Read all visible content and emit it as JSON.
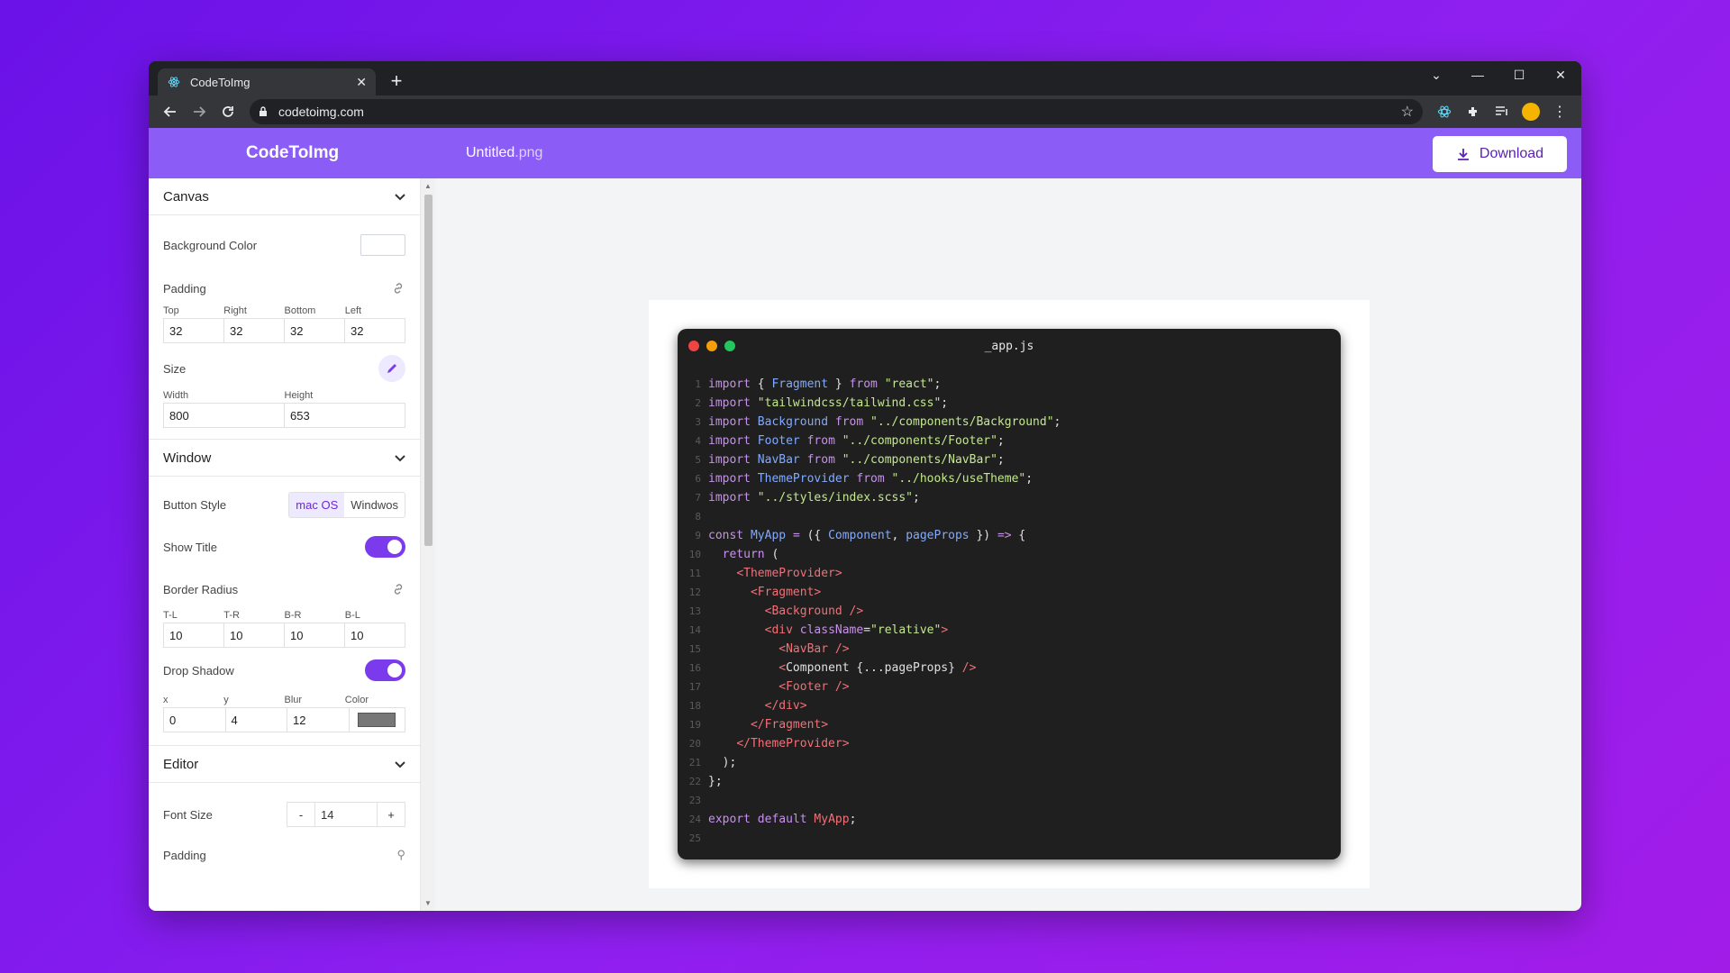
{
  "browser": {
    "tab_title": "CodeToImg",
    "url": "codetoimg.com"
  },
  "app": {
    "brand": "CodeToImg",
    "filename_base": "Untitled",
    "filename_ext": ".png",
    "download_label": "Download"
  },
  "sidebar": {
    "canvas": {
      "title": "Canvas",
      "bg_color_label": "Background Color",
      "bg_color": "#ffffff",
      "padding_label": "Padding",
      "padding_fields": [
        "Top",
        "Right",
        "Bottom",
        "Left"
      ],
      "padding_values": [
        "32",
        "32",
        "32",
        "32"
      ],
      "size_label": "Size",
      "size_fields": [
        "Width",
        "Height"
      ],
      "size_values": [
        "800",
        "653"
      ]
    },
    "window": {
      "title": "Window",
      "button_style_label": "Button Style",
      "button_style_options": [
        "mac OS",
        "Windwos"
      ],
      "button_style_selected": "mac OS",
      "show_title_label": "Show Title",
      "show_title": true,
      "border_radius_label": "Border Radius",
      "radius_fields": [
        "T-L",
        "T-R",
        "B-R",
        "B-L"
      ],
      "radius_values": [
        "10",
        "10",
        "10",
        "10"
      ],
      "drop_shadow_label": "Drop Shadow",
      "drop_shadow": true,
      "shadow_fields": [
        "x",
        "y",
        "Blur",
        "Color"
      ],
      "shadow_values": [
        "0",
        "4",
        "12"
      ],
      "shadow_color": "#777777"
    },
    "editor": {
      "title": "Editor",
      "font_size_label": "Font Size",
      "font_size": "14",
      "minus": "-",
      "plus": "+",
      "padding_label": "Padding"
    }
  },
  "code_window": {
    "title": "_app.js",
    "dot_colors": [
      "#ef4444",
      "#f59e0b",
      "#22c55e"
    ],
    "lines": [
      [
        [
          "k",
          "import"
        ],
        [
          "p",
          " { "
        ],
        [
          "c",
          "Fragment"
        ],
        [
          "p",
          " } "
        ],
        [
          "k",
          "from"
        ],
        [
          "p",
          " "
        ],
        [
          "s",
          "\"react\""
        ],
        [
          "p",
          ";"
        ]
      ],
      [
        [
          "k",
          "import"
        ],
        [
          "p",
          " "
        ],
        [
          "s",
          "\"tailwindcss/tailwind.css\""
        ],
        [
          "p",
          ";"
        ]
      ],
      [
        [
          "k",
          "import"
        ],
        [
          "p",
          " "
        ],
        [
          "c",
          "Background"
        ],
        [
          "p",
          " "
        ],
        [
          "k",
          "from"
        ],
        [
          "p",
          " "
        ],
        [
          "s",
          "\"../components/Background\""
        ],
        [
          "p",
          ";"
        ]
      ],
      [
        [
          "k",
          "import"
        ],
        [
          "p",
          " "
        ],
        [
          "c",
          "Footer"
        ],
        [
          "p",
          " "
        ],
        [
          "k",
          "from"
        ],
        [
          "p",
          " "
        ],
        [
          "s",
          "\"../components/Footer\""
        ],
        [
          "p",
          ";"
        ]
      ],
      [
        [
          "k",
          "import"
        ],
        [
          "p",
          " "
        ],
        [
          "c",
          "NavBar"
        ],
        [
          "p",
          " "
        ],
        [
          "k",
          "from"
        ],
        [
          "p",
          " "
        ],
        [
          "s",
          "\"../components/NavBar\""
        ],
        [
          "p",
          ";"
        ]
      ],
      [
        [
          "k",
          "import"
        ],
        [
          "p",
          " "
        ],
        [
          "c",
          "ThemeProvider"
        ],
        [
          "p",
          " "
        ],
        [
          "k",
          "from"
        ],
        [
          "p",
          " "
        ],
        [
          "s",
          "\"../hooks/useTheme\""
        ],
        [
          "p",
          ";"
        ]
      ],
      [
        [
          "k",
          "import"
        ],
        [
          "p",
          " "
        ],
        [
          "s",
          "\"../styles/index.scss\""
        ],
        [
          "p",
          ";"
        ]
      ],
      [],
      [
        [
          "k",
          "const"
        ],
        [
          "p",
          " "
        ],
        [
          "c",
          "MyApp"
        ],
        [
          "p",
          " "
        ],
        [
          "k",
          "="
        ],
        [
          "p",
          " ({ "
        ],
        [
          "c",
          "Component"
        ],
        [
          "p",
          ", "
        ],
        [
          "c",
          "pageProps"
        ],
        [
          "p",
          " }) "
        ],
        [
          "k",
          "=>"
        ],
        [
          "p",
          " {"
        ]
      ],
      [
        [
          "p",
          "  "
        ],
        [
          "k",
          "return"
        ],
        [
          "p",
          " ("
        ]
      ],
      [
        [
          "p",
          "    "
        ],
        [
          "t",
          "<ThemeProvider>"
        ]
      ],
      [
        [
          "p",
          "      "
        ],
        [
          "t",
          "<Fragment>"
        ]
      ],
      [
        [
          "p",
          "        "
        ],
        [
          "t",
          "<Background />"
        ]
      ],
      [
        [
          "p",
          "        "
        ],
        [
          "t",
          "<div "
        ],
        [
          "a",
          "className"
        ],
        [
          "p",
          "="
        ],
        [
          "s",
          "\"relative\""
        ],
        [
          "t",
          ">"
        ]
      ],
      [
        [
          "p",
          "          "
        ],
        [
          "t",
          "<NavBar />"
        ]
      ],
      [
        [
          "p",
          "          "
        ],
        [
          "t",
          "<"
        ],
        [
          "p",
          "Component {...pageProps} "
        ],
        [
          "t",
          "/>"
        ]
      ],
      [
        [
          "p",
          "          "
        ],
        [
          "t",
          "<Footer />"
        ]
      ],
      [
        [
          "p",
          "        "
        ],
        [
          "t",
          "</div>"
        ]
      ],
      [
        [
          "p",
          "      "
        ],
        [
          "t",
          "</Fragment>"
        ]
      ],
      [
        [
          "p",
          "    "
        ],
        [
          "t",
          "</ThemeProvider>"
        ]
      ],
      [
        [
          "p",
          "  );"
        ]
      ],
      [
        [
          "p",
          "};"
        ]
      ],
      [],
      [
        [
          "k",
          "export"
        ],
        [
          "p",
          " "
        ],
        [
          "k",
          "default"
        ],
        [
          "p",
          " "
        ],
        [
          "t",
          "MyApp"
        ],
        [
          "p",
          ";"
        ]
      ],
      []
    ]
  }
}
